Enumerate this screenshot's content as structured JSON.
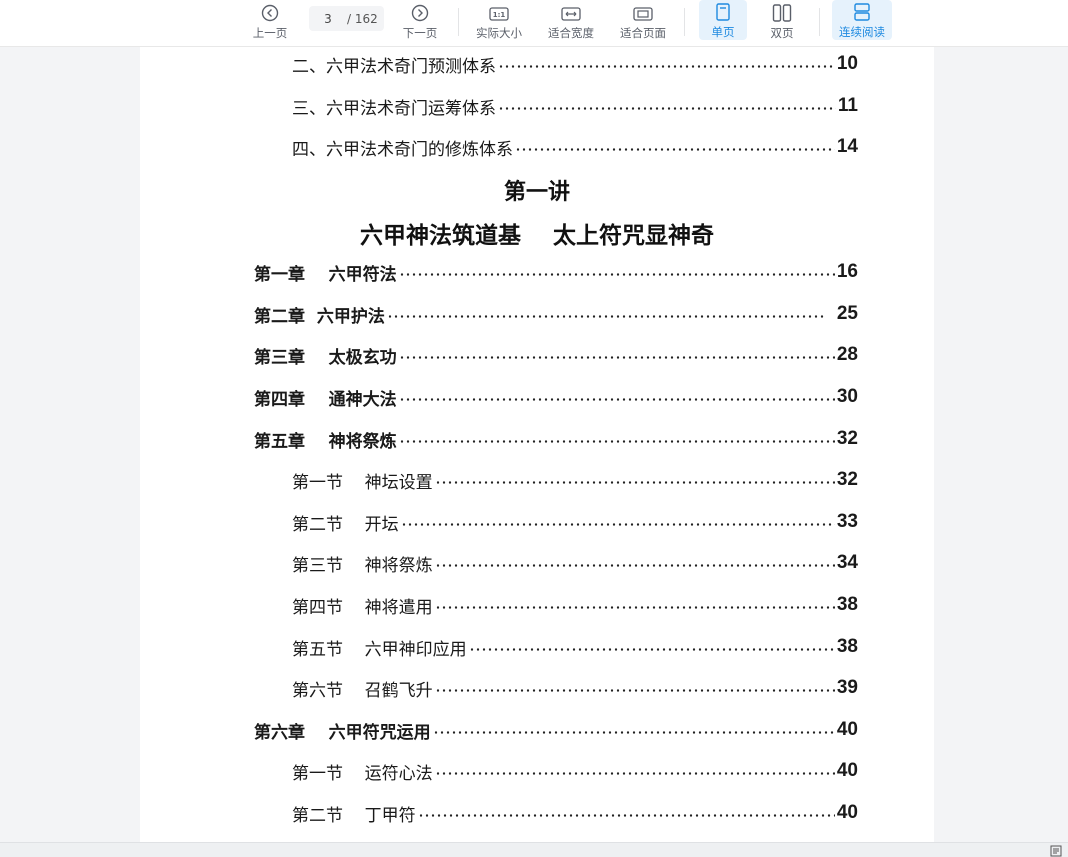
{
  "toolbar": {
    "prev_label": "上一页",
    "next_label": "下一页",
    "current_page": "3",
    "total_pages": "/ 162",
    "actual_size_label": "实际大小",
    "fit_width_label": "适合宽度",
    "fit_page_label": "适合页面",
    "single_page_label": "单页",
    "double_page_label": "双页",
    "continuous_label": "连续阅读",
    "actual_size_glyph": "1:1"
  },
  "colors": {
    "accent": "#1f8ae0",
    "active_bg": "#e6f2fc"
  },
  "document": {
    "heading_lecture": "第一讲",
    "heading_title": "六甲神法筑道基    太上符咒显神奇",
    "toc_top": [
      {
        "title": "二、六甲法术奇门预测体系",
        "page": "10"
      },
      {
        "title": "三、六甲法术奇门运筹体系",
        "page": "11"
      },
      {
        "title": "四、六甲法术奇门的修炼体系",
        "page": "14"
      }
    ],
    "toc_main": [
      {
        "title": "第一章    六甲符法",
        "page": "16",
        "level": "chap"
      },
      {
        "title": "第二章  六甲护法",
        "page": "25",
        "level": "chap"
      },
      {
        "title": "第三章    太极玄功",
        "page": "28",
        "level": "chap"
      },
      {
        "title": "第四章    通神大法",
        "page": "30",
        "level": "chap"
      },
      {
        "title": "第五章    神将祭炼",
        "page": "32",
        "level": "chap"
      },
      {
        "title": "第一节    神坛设置",
        "page": "32",
        "level": "sec"
      },
      {
        "title": "第二节    开坛",
        "page": "33",
        "level": "sec"
      },
      {
        "title": "第三节    神将祭炼",
        "page": "34",
        "level": "sec"
      },
      {
        "title": "第四节    神将遣用",
        "page": "38",
        "level": "sec"
      },
      {
        "title": "第五节    六甲神印应用",
        "page": "38",
        "level": "sec"
      },
      {
        "title": "第六节    召鹤飞升",
        "page": "39",
        "level": "sec"
      },
      {
        "title": "第六章    六甲符咒运用",
        "page": "40",
        "level": "chap"
      },
      {
        "title": "第一节    运符心法",
        "page": "40",
        "level": "sec"
      },
      {
        "title": "第二节    丁甲符",
        "page": "40",
        "level": "sec"
      }
    ]
  }
}
